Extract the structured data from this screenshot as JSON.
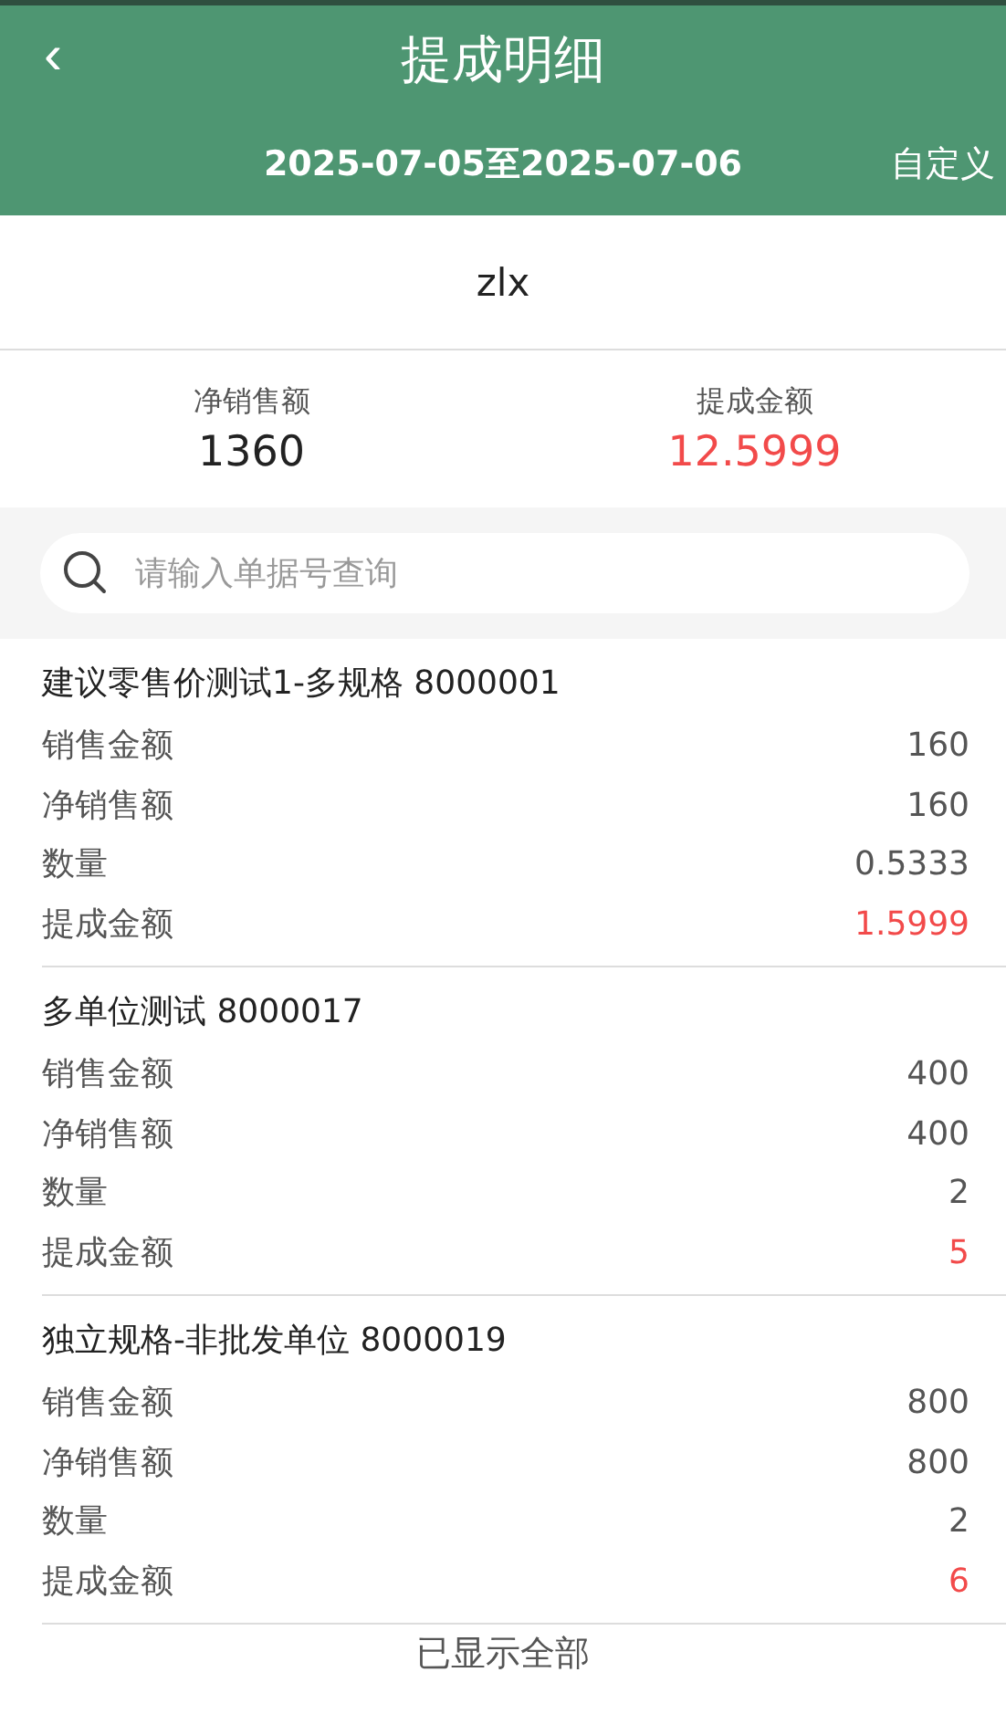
{
  "header": {
    "back": "‹",
    "title": "提成明细",
    "date_range": "2025-07-05至2025-07-06",
    "custom": "自定义"
  },
  "person": "zlx",
  "summary": [
    {
      "label": "净销售额",
      "value": "1360",
      "highlight": false
    },
    {
      "label": "提成金额",
      "value": "12.5999",
      "highlight": true
    }
  ],
  "search": {
    "placeholder": "请输入单据号查询"
  },
  "orders": [
    {
      "title": "建议零售价测试1-多规格 8000001",
      "fields": [
        {
          "label": "销售金额",
          "value": "160",
          "highlight": false
        },
        {
          "label": "净销售额",
          "value": "160",
          "highlight": false
        },
        {
          "label": "数量",
          "value": "0.5333",
          "highlight": false
        },
        {
          "label": "提成金额",
          "value": "1.5999",
          "highlight": true
        }
      ]
    },
    {
      "title": "多单位测试 8000017",
      "fields": [
        {
          "label": "销售金额",
          "value": "400",
          "highlight": false
        },
        {
          "label": "净销售额",
          "value": "400",
          "highlight": false
        },
        {
          "label": "数量",
          "value": "2",
          "highlight": false
        },
        {
          "label": "提成金额",
          "value": "5",
          "highlight": true
        }
      ]
    },
    {
      "title": "独立规格-非批发单位 8000019",
      "fields": [
        {
          "label": "销售金额",
          "value": "800",
          "highlight": false
        },
        {
          "label": "净销售额",
          "value": "800",
          "highlight": false
        },
        {
          "label": "数量",
          "value": "2",
          "highlight": false
        },
        {
          "label": "提成金额",
          "value": "6",
          "highlight": true
        }
      ]
    }
  ],
  "footer": "已显示全部"
}
